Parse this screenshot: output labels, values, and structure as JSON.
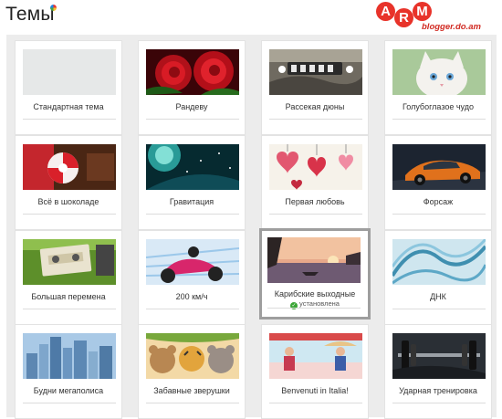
{
  "header": {
    "title": "Темы"
  },
  "watermark": {
    "letters": [
      "A",
      "R",
      "M"
    ],
    "subtitle": "blogger.do.am"
  },
  "themes": [
    {
      "label": "Стандартная тема"
    },
    {
      "label": "Рандеву"
    },
    {
      "label": "Рассекая дюны"
    },
    {
      "label": "Голубоглазое чудо"
    },
    {
      "label": "Всё в шоколаде"
    },
    {
      "label": "Гравитация"
    },
    {
      "label": "Первая любовь"
    },
    {
      "label": "Форсаж"
    },
    {
      "label": "Большая перемена"
    },
    {
      "label": "200 км/ч"
    },
    {
      "label": "Карибские выходные",
      "status": "установлена"
    },
    {
      "label": "ДНК"
    },
    {
      "label": "Будни мегаполиса"
    },
    {
      "label": "Забавные зверушки"
    },
    {
      "label": "Benvenuti in Italia!"
    },
    {
      "label": "Ударная тренировка"
    }
  ],
  "selected_theme": "Карибские выходные"
}
